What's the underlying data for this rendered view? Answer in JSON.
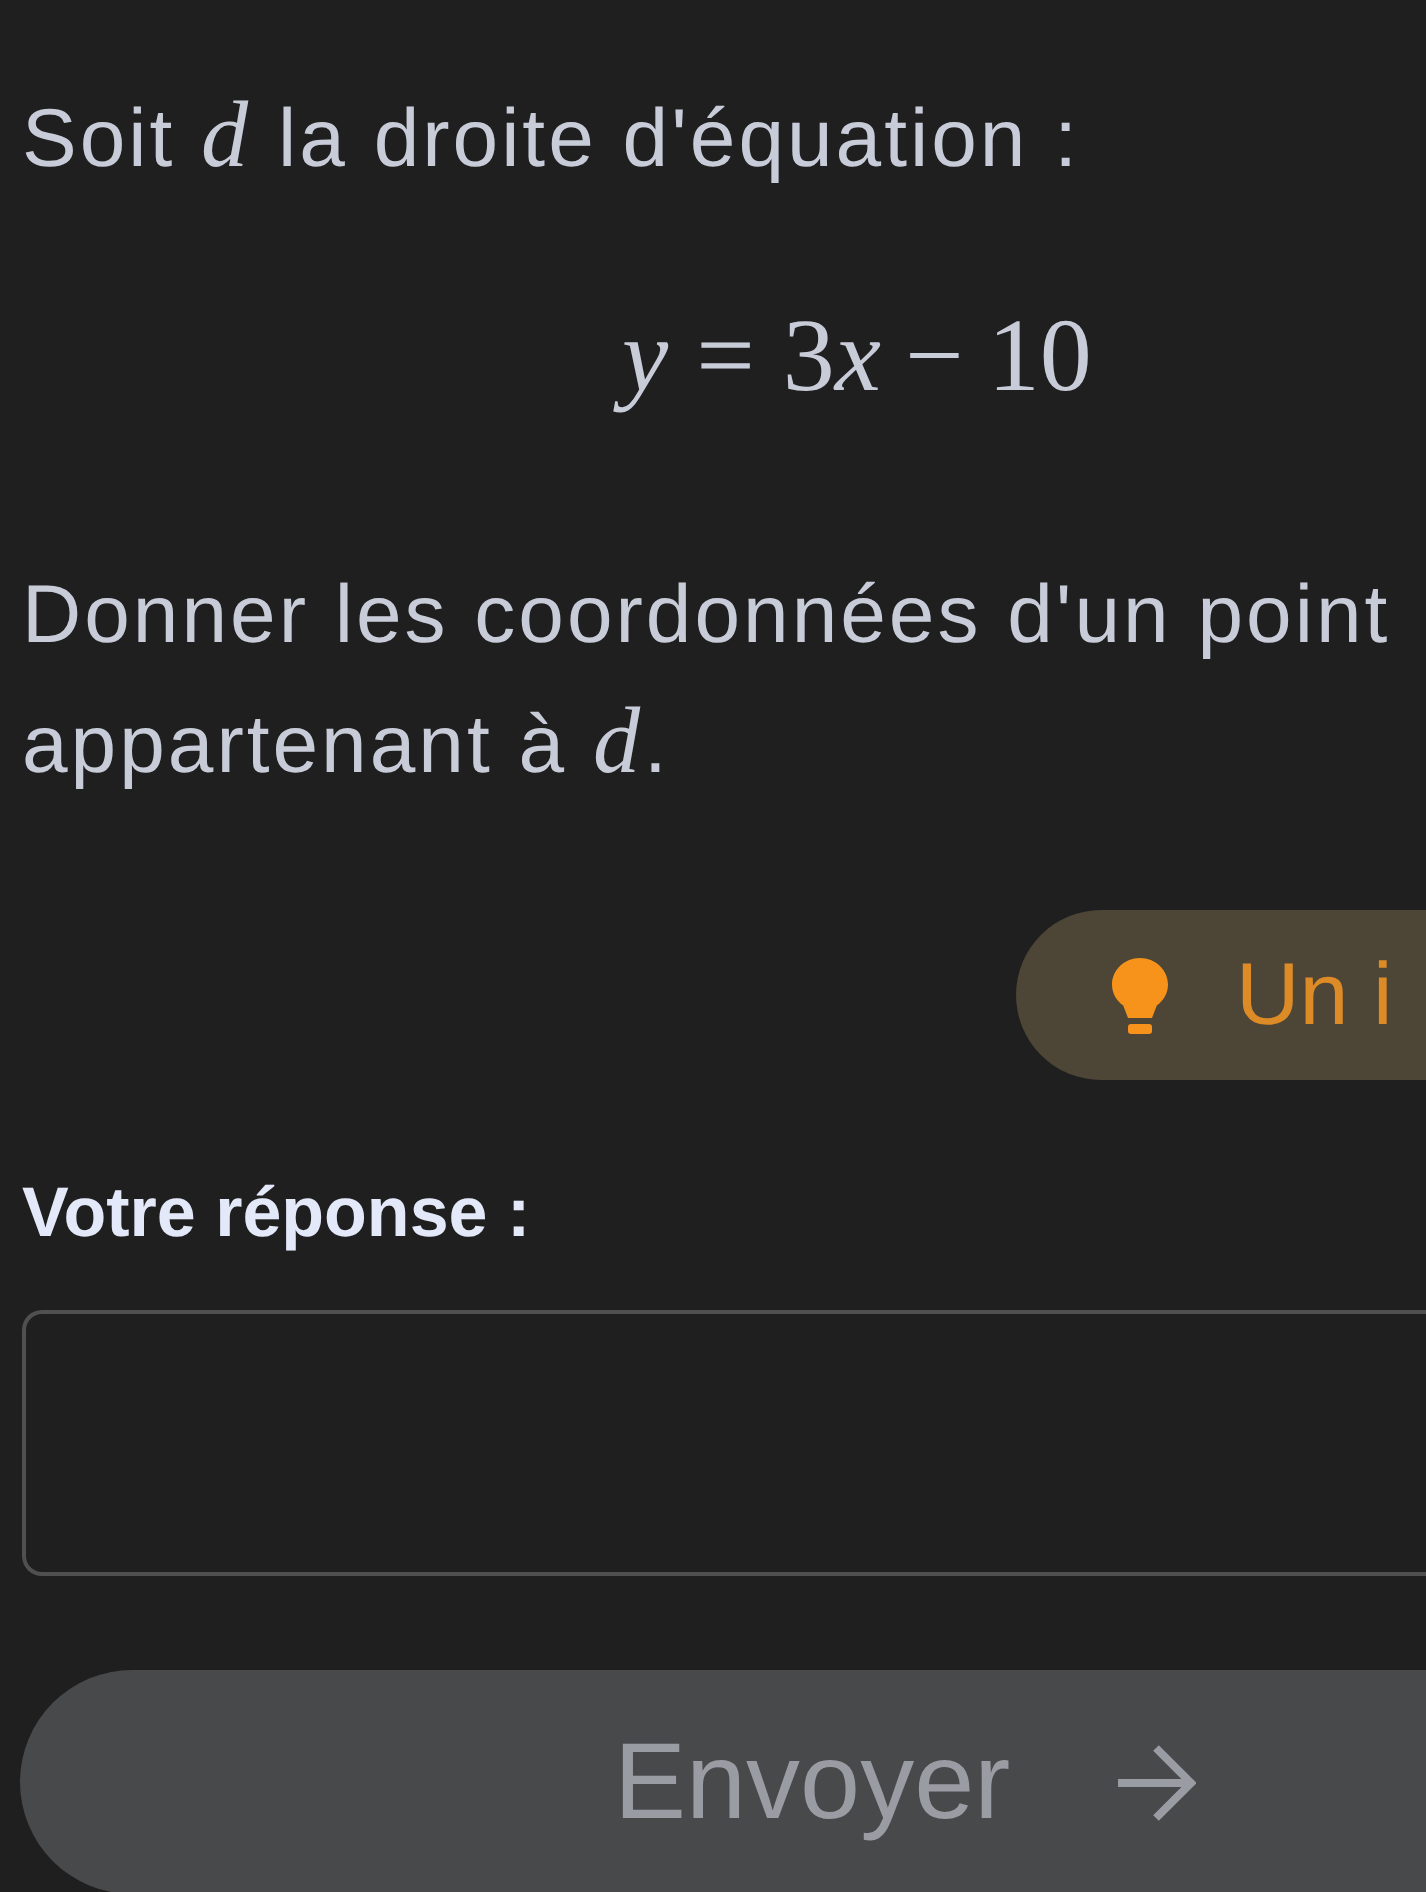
{
  "question": [
    {
      "kind": "text",
      "text": "Soit *d* la droite d'équation :"
    },
    {
      "kind": "equation",
      "parts": [
        {
          "kind": "var",
          "text": "y"
        },
        {
          "kind": "rel",
          "text": "="
        },
        {
          "kind": "num",
          "text": "3"
        },
        {
          "kind": "var",
          "text": "x"
        },
        {
          "kind": "bin",
          "text": "−"
        },
        {
          "kind": "num",
          "text": "10"
        }
      ]
    },
    {
      "kind": "text",
      "text": "Donner les coordonnées d'un point appartenant à *d*."
    }
  ],
  "hint_button": {
    "label": "Un i"
  },
  "answer": {
    "label": "Votre réponse :"
  },
  "submit_button": {
    "label": "Envoyer",
    "disabled": true
  }
}
